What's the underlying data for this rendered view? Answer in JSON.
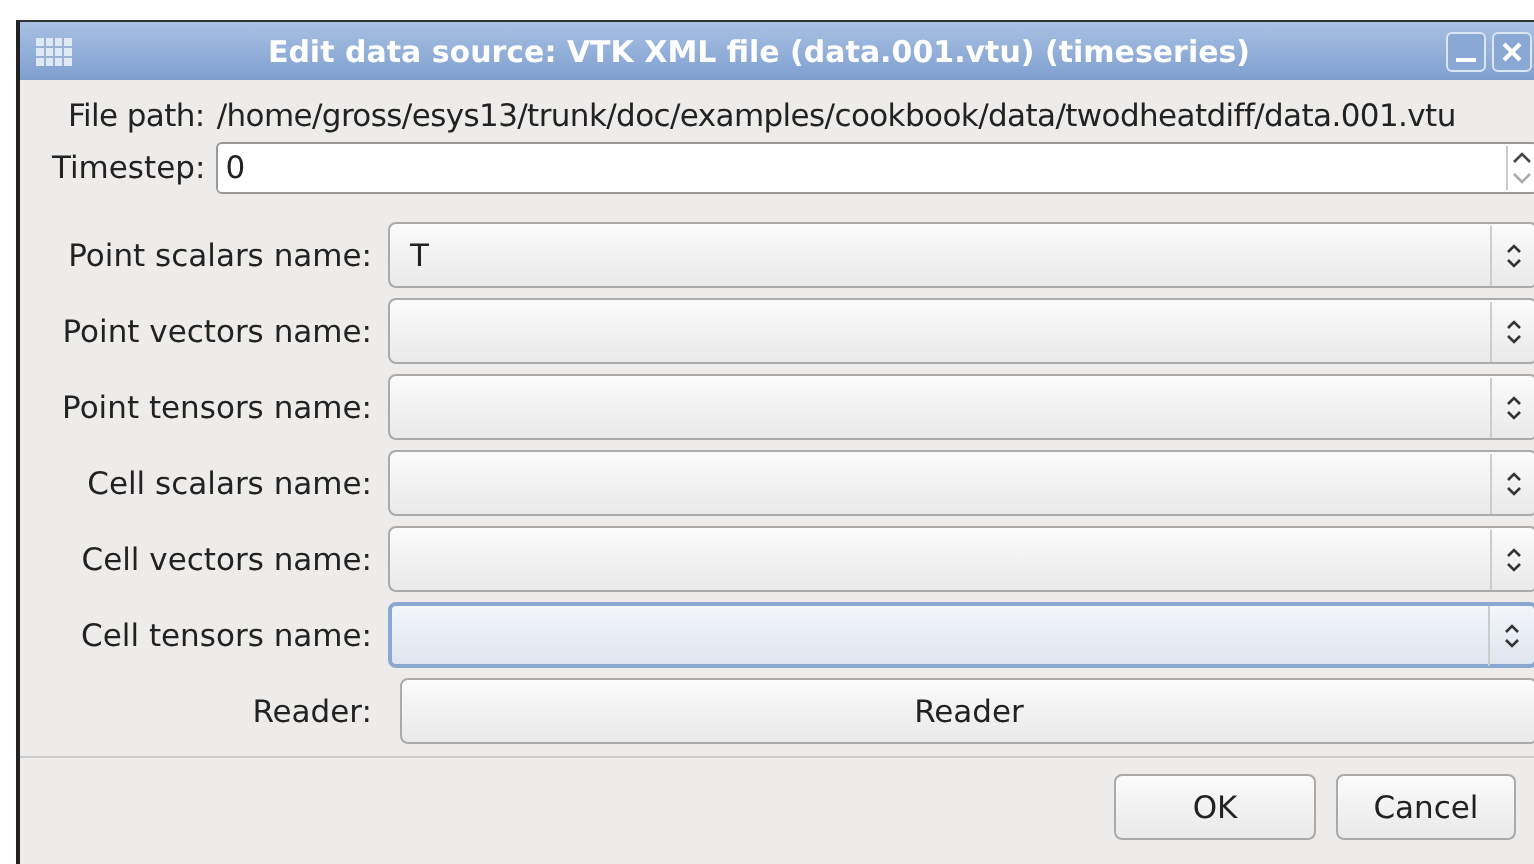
{
  "window": {
    "title": "Edit data source: VTK XML file (data.001.vtu) (timeseries)"
  },
  "file_path": {
    "label": "File path:",
    "value": "/home/gross/esys13/trunk/doc/examples/cookbook/data/twodheatdiff/data.001.vtu"
  },
  "timestep": {
    "label": "Timestep:",
    "value": "0"
  },
  "fields": [
    {
      "label": "Point scalars name:",
      "value": "T",
      "focused": false
    },
    {
      "label": "Point vectors name:",
      "focused": false
    },
    {
      "label": "Point tensors name:",
      "focused": false
    },
    {
      "label": "Cell scalars name:",
      "focused": false
    },
    {
      "label": "Cell vectors name:",
      "focused": false
    },
    {
      "label": "Cell tensors name:",
      "focused": true
    }
  ],
  "reader": {
    "label": "Reader:",
    "button": "Reader"
  },
  "buttons": [
    "OK",
    "Cancel"
  ]
}
